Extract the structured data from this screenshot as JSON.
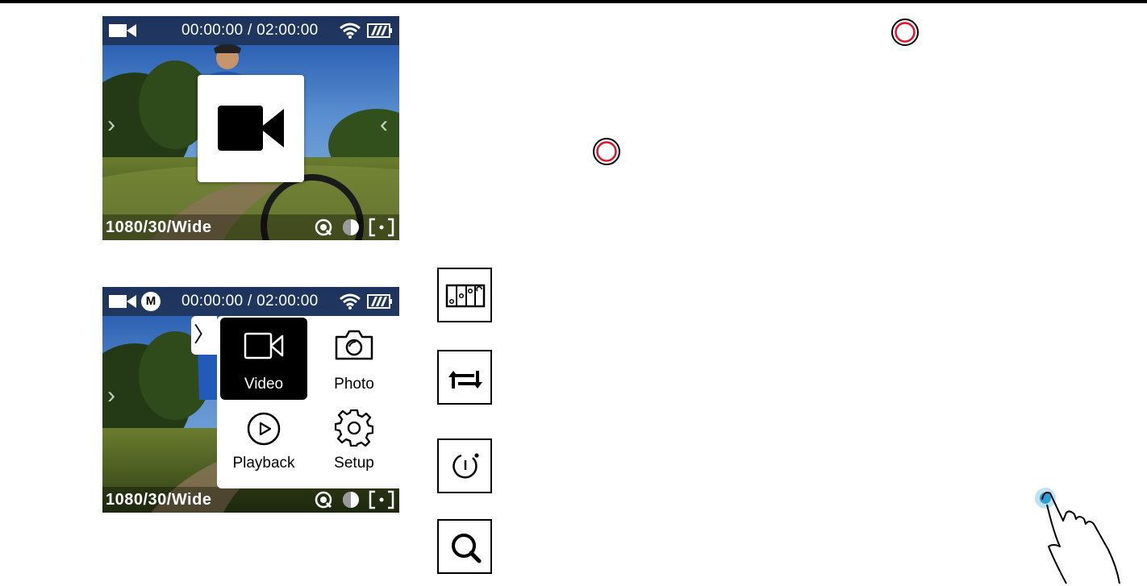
{
  "screen1": {
    "timecode": "00:00:00 / 02:00:00",
    "resolution": "1080/30/Wide",
    "popup_icon": "video-camera-icon"
  },
  "screen2": {
    "mode_badge": "M",
    "timecode": "00:00:00 / 02:00:00",
    "resolution": "1080/30/Wide",
    "menu": {
      "items": [
        {
          "label": "Video",
          "icon": "video-camera-icon",
          "active": true
        },
        {
          "label": "Photo",
          "icon": "camera-icon",
          "active": false
        },
        {
          "label": "Playback",
          "icon": "play-icon",
          "active": false
        },
        {
          "label": "Setup",
          "icon": "gear-icon",
          "active": false
        }
      ]
    }
  },
  "side_icons": [
    "timeline-icon",
    "swap-arrows-icon",
    "power-timer-icon",
    "search-icon"
  ],
  "colors": {
    "record_ring": "#e8102a",
    "touch_dot": "#2a9fd6",
    "status_bar": "#1e2d4b"
  }
}
